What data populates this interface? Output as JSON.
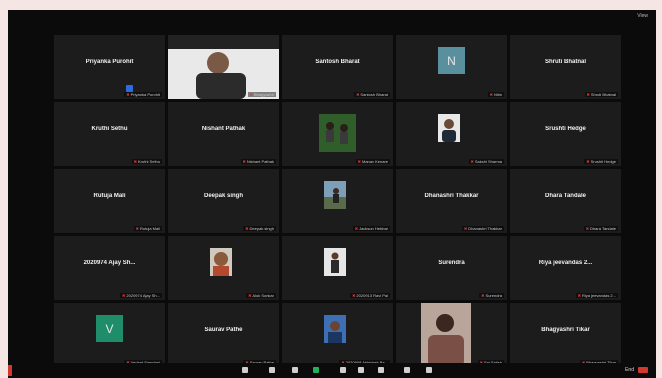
{
  "window": {
    "corner_text": "View"
  },
  "tiles": [
    {
      "name": "Priyanka Purohit",
      "label": "Priyanka Purohit",
      "kind": "name"
    },
    {
      "name": "",
      "label": "Bhagyashri",
      "kind": "video"
    },
    {
      "name": "Santosh Bharat",
      "label": "Santosh Bharat",
      "kind": "name"
    },
    {
      "name": "",
      "label": "Nitin",
      "kind": "avatar",
      "initial": "N",
      "color": "#5a8f9e"
    },
    {
      "name": "Shruti Bhatnal",
      "label": "Shruti Bhatnal",
      "kind": "name"
    },
    {
      "name": "Kruthi Sethu",
      "label": "Kruthi Sethu",
      "kind": "name"
    },
    {
      "name": "Nishant Pathak",
      "label": "Nishant Pathak",
      "kind": "name"
    },
    {
      "name": "",
      "label": "Manav Kenare",
      "kind": "video2"
    },
    {
      "name": "",
      "label": "Sakshi Sharma",
      "kind": "photo",
      "photo": "person"
    },
    {
      "name": "Srushti Hedge",
      "label": "Srushti Hedge",
      "kind": "name"
    },
    {
      "name": "Rutuja Mali",
      "label": "Rutuja Mali",
      "kind": "name"
    },
    {
      "name": "Deepak singh",
      "label": "Deepak singh",
      "kind": "name"
    },
    {
      "name": "",
      "label": "Jackson Hebbar",
      "kind": "photo",
      "photo": "outdoor"
    },
    {
      "name": "Dhanashri Thakkar",
      "label": "Dhanashri Thakkar",
      "kind": "name"
    },
    {
      "name": "Dhara Tandale",
      "label": "Dhara Tandale",
      "kind": "name"
    },
    {
      "name": "2020974 Ajay Sh...",
      "label": "2020974 Ajay Sh...",
      "kind": "name"
    },
    {
      "name": "",
      "label": "Alok Sonkar",
      "kind": "photo",
      "photo": "face"
    },
    {
      "name": "",
      "label": "2020913 Ravi Pal",
      "kind": "photo",
      "photo": "standing"
    },
    {
      "name": "Surendra",
      "label": "Surendra",
      "kind": "name"
    },
    {
      "name": "Riya jeevandas 2...",
      "label": "Riya jeevandas 2...",
      "kind": "name"
    },
    {
      "name": "",
      "label": "Vedant Samdani",
      "kind": "avatar",
      "initial": "V",
      "color": "#1f8c6a"
    },
    {
      "name": "Saurav Pathe",
      "label": "Saurav Pathe",
      "kind": "name"
    },
    {
      "name": "",
      "label": "2020908 Abhishek Ba...",
      "kind": "photo",
      "photo": "blue"
    },
    {
      "name": "",
      "label": "Sai Satish",
      "kind": "photo2"
    },
    {
      "name": "Bhagyashri Tikar",
      "label": "Bhagyashri Tikar",
      "kind": "name"
    }
  ],
  "controls": {
    "end_label": "End"
  }
}
